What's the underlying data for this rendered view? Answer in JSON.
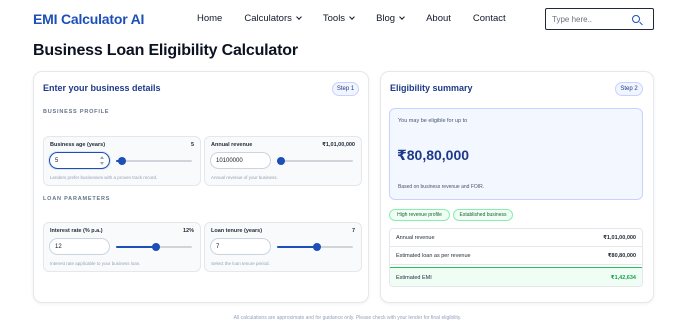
{
  "header": {
    "brand": "EMI Calculator AI",
    "nav": [
      {
        "label": "Home",
        "dropdown": false
      },
      {
        "label": "Calculators",
        "dropdown": true
      },
      {
        "label": "Tools",
        "dropdown": true
      },
      {
        "label": "Blog",
        "dropdown": true
      },
      {
        "label": "About",
        "dropdown": false
      },
      {
        "label": "Contact",
        "dropdown": false
      }
    ],
    "search_placeholder": "Type here..",
    "search_value": ""
  },
  "page_title": "Business Loan Eligibility Calculator",
  "left_card": {
    "title": "Enter your business details",
    "step": "Step 1",
    "section_profile": "BUSINESS PROFILE",
    "section_loan": "LOAN PARAMETERS",
    "fields": [
      {
        "label": "Business age (years)",
        "value_display": "5",
        "input": "5",
        "hint": "Lenders prefer businesses with a proven track record.",
        "slider_pct": 0.08,
        "focused": true,
        "spinner": true
      },
      {
        "label": "Annual revenue",
        "value_display": "₹1,01,00,000",
        "input": "10100000",
        "hint": "Annual revenue of your business.",
        "slider_pct": 0.05,
        "focused": false,
        "spinner": false
      },
      {
        "label": "Interest rate (% p.a.)",
        "value_display": "12%",
        "input": "12",
        "hint": "Interest rate applicable to your business loan.",
        "slider_pct": 0.52,
        "focused": false,
        "spinner": false
      },
      {
        "label": "Loan tenure (years)",
        "value_display": "7",
        "input": "7",
        "hint": "Select the loan tenure period.",
        "slider_pct": 0.52,
        "focused": false,
        "spinner": false
      }
    ]
  },
  "right_card": {
    "title": "Eligibility summary",
    "step": "Step 2",
    "eligible_label": "You may be eligible for up to",
    "eligible_amount": "₹80,80,000",
    "note": "Based on business revenue and FOIR.",
    "tags": [
      "High revenue profile",
      "Established business"
    ],
    "rows": [
      {
        "label": "Annual revenue",
        "value": "₹1,01,00,000"
      },
      {
        "label": "Estimated loan as per revenue",
        "value": "₹80,80,000"
      },
      {
        "label": "Estimated EMI",
        "value": "₹1,42,634"
      }
    ]
  },
  "footer": "All calculations are approximate and for guidance only. Please check with your lender for final eligibility.",
  "colors": {
    "accent": "#1d4fb8",
    "success": "#16a34a"
  }
}
